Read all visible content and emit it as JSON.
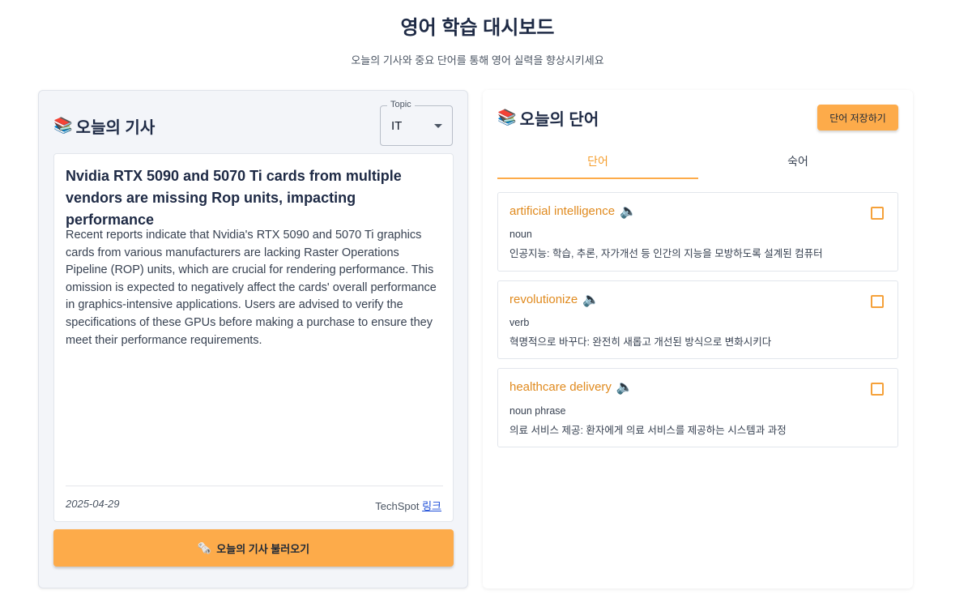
{
  "header": {
    "title": "영어 학습 대시보드",
    "subtitle": "오늘의 기사와 중요 단어를 통해 영어 실력을 향상시키세요"
  },
  "article_panel": {
    "icon": "books-icon",
    "title": "오늘의 기사",
    "topic_label": "Topic",
    "topic_value": "IT",
    "headline": "Nvidia RTX 5090 and 5070 Ti cards from multiple vendors are missing Rop units, impacting performance",
    "body": "Recent reports indicate that Nvidia's RTX 5090 and 5070 Ti graphics cards from various manufacturers are lacking Raster Operations Pipeline (ROP) units, which are crucial for rendering performance. This omission is expected to negatively affect the cards' overall performance in graphics-intensive applications. Users are advised to verify the specifications of these GPUs before making a purchase to ensure they meet their performance requirements.",
    "date": "2025-04-29",
    "source": "TechSpot",
    "link_label": "링크",
    "load_button_icon": "newspaper-icon",
    "load_button_label": "오늘의 기사 불러오기"
  },
  "words_panel": {
    "icon": "books-icon",
    "title": "오늘의 단어",
    "save_button_label": "단어 저장하기",
    "tabs": [
      {
        "label": "단어",
        "active": true
      },
      {
        "label": "숙어",
        "active": false
      }
    ],
    "words": [
      {
        "term": "artificial intelligence",
        "pos": "noun",
        "meaning": "인공지능: 학습, 추론, 자가개선 등 인간의 지능을 모방하도록 설계된 컴퓨터",
        "checked": false
      },
      {
        "term": "revolutionize",
        "pos": "verb",
        "meaning": "혁명적으로 바꾸다: 완전히 새롭고 개선된 방식으로 변화시키다",
        "checked": false
      },
      {
        "term": "healthcare delivery",
        "pos": "noun phrase",
        "meaning": "의료 서비스 제공: 환자에게 의료 서비스를 제공하는 시스템과 과정",
        "checked": false
      }
    ]
  },
  "colors": {
    "accent": "#fdab4a",
    "term": "#e08a1e",
    "title": "#1e2a45",
    "link": "#1d4ed8"
  }
}
